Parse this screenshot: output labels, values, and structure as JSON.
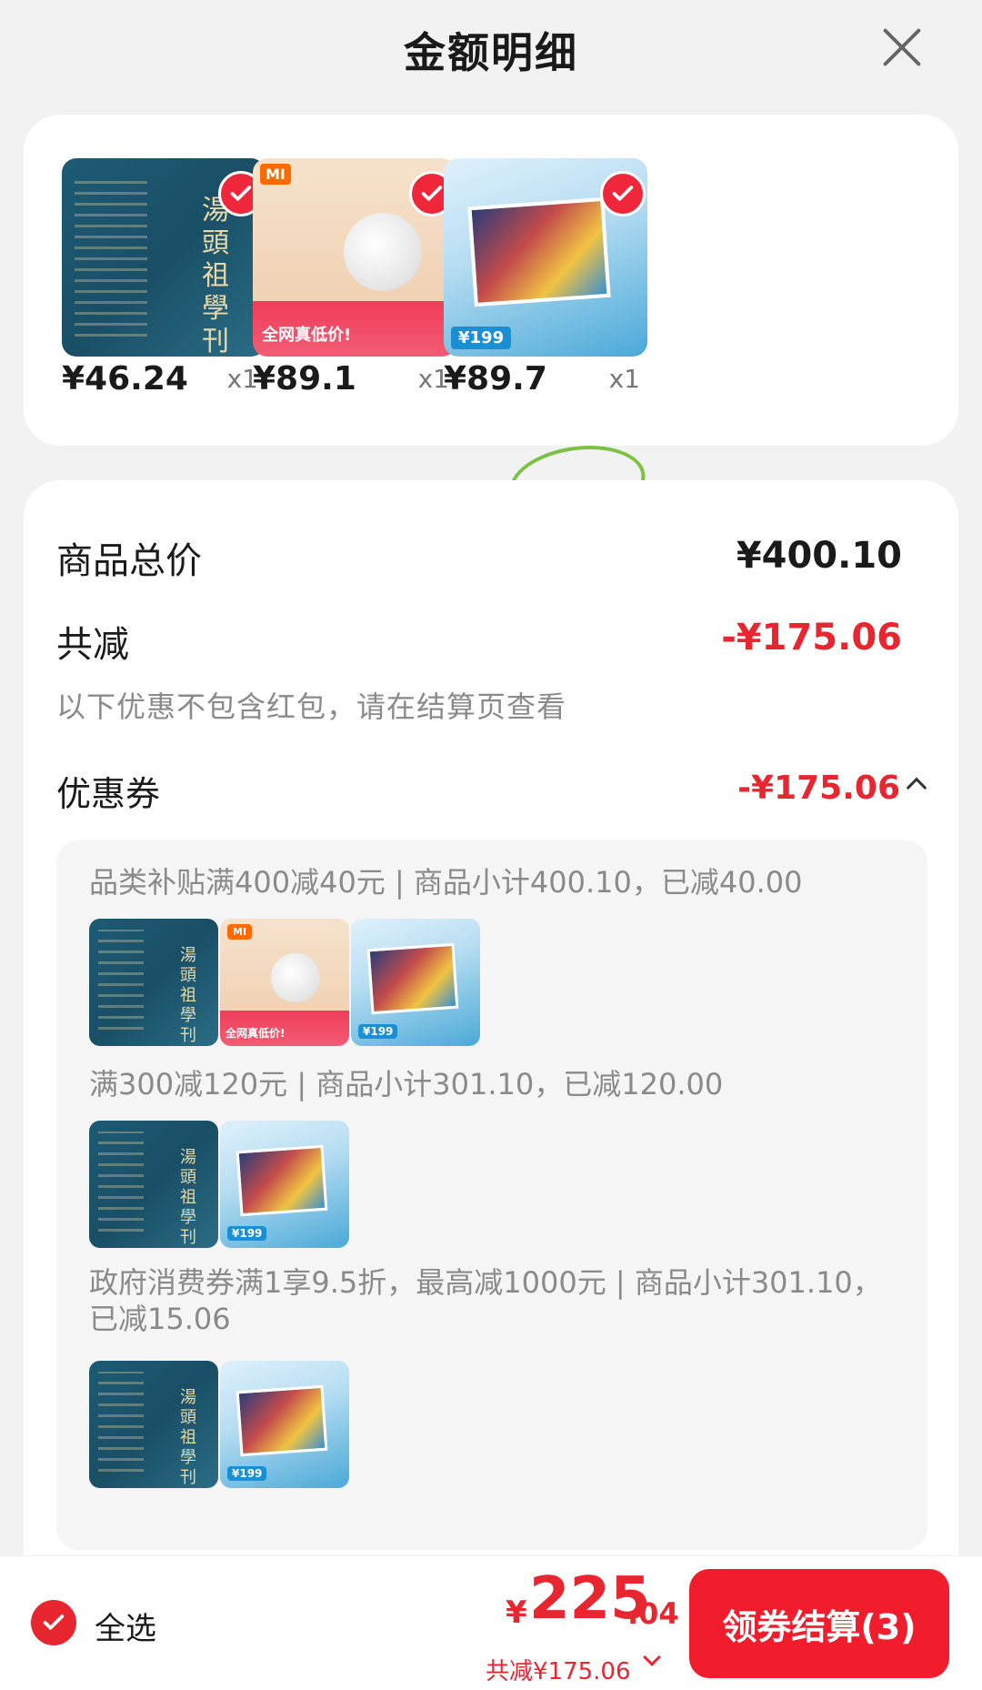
{
  "header": {
    "title": "金额明细",
    "close_icon": "close-icon"
  },
  "products": [
    {
      "price": "¥46.24",
      "qty": "x1",
      "type": "book",
      "title": "湯頭祖學刊",
      "checked": true
    },
    {
      "price": "¥89.1",
      "qty": "x1",
      "type": "mi",
      "label": "全网真低价!",
      "logo": "MI",
      "checked": true
    },
    {
      "price": "¥89.7",
      "qty": "x1",
      "type": "magazine",
      "label": "¥199",
      "checked": true
    }
  ],
  "summary": {
    "total_label": "商品总价",
    "total_value": "¥400.10",
    "discount_label": "共减",
    "discount_value": "-¥175.06",
    "note": "以下优惠不包含红包，请在结算页查看",
    "coupon_label": "优惠券",
    "coupon_value": "-¥175.06"
  },
  "coupons": [
    {
      "text": "品类补贴满400减40元 | 商品小计400.10，已减40.00",
      "items": [
        "book",
        "mi",
        "magazine"
      ]
    },
    {
      "text": "满300减120元 | 商品小计301.10，已减120.00",
      "items": [
        "book",
        "magazine"
      ]
    },
    {
      "text": "政府消费券满1享9.5折，最高减1000元 | 商品小计301.10，已减15.06",
      "items": [
        "book",
        "magazine"
      ]
    }
  ],
  "bottom": {
    "select_all": "全选",
    "currency": "¥",
    "total_int": "225",
    "total_dec": ".04",
    "discount_note": "共减¥175.06",
    "checkout": "领券结算(3)"
  },
  "colors": {
    "accent": "#e8262f",
    "button": "#f21d2c"
  }
}
